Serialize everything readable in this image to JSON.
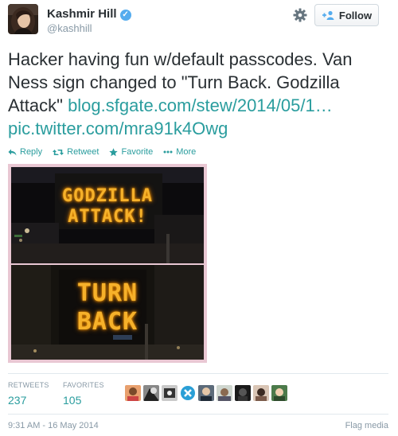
{
  "author": {
    "name": "Kashmir Hill",
    "handle": "@kashhill",
    "verified": true
  },
  "header": {
    "follow_label": "Follow",
    "settings_icon": "gear-icon"
  },
  "tweet": {
    "text_plain": "Hacker having fun w/default passcodes. Van Ness sign changed to \"Turn Back. Godzilla Attack\" ",
    "link_url": "blog.sfgate.com/stew/2014/05/1…",
    "pic_url": "pic.twitter.com/mra91k4Owg"
  },
  "actions": [
    {
      "label": "Reply",
      "icon": "reply-icon"
    },
    {
      "label": "Retweet",
      "icon": "retweet-icon"
    },
    {
      "label": "Favorite",
      "icon": "star-icon"
    },
    {
      "label": "More",
      "icon": "more-dots-icon"
    }
  ],
  "media": {
    "top_sign": [
      "GODZILLA",
      "ATTACK!"
    ],
    "bottom_sign": [
      "TURN",
      "BACK"
    ]
  },
  "stats": {
    "retweets_label": "RETWEETS",
    "retweets_value": "237",
    "favorites_label": "FAVORITES",
    "favorites_value": "105"
  },
  "footer": {
    "timestamp": "9:31 AM - 16 May 2014",
    "flag_label": "Flag media"
  },
  "colors": {
    "link": "#2a9d9e",
    "muted": "#8899a6",
    "verified": "#55acee",
    "media_border": "#e9c7d3",
    "sign_glow": "#f6b12a"
  }
}
